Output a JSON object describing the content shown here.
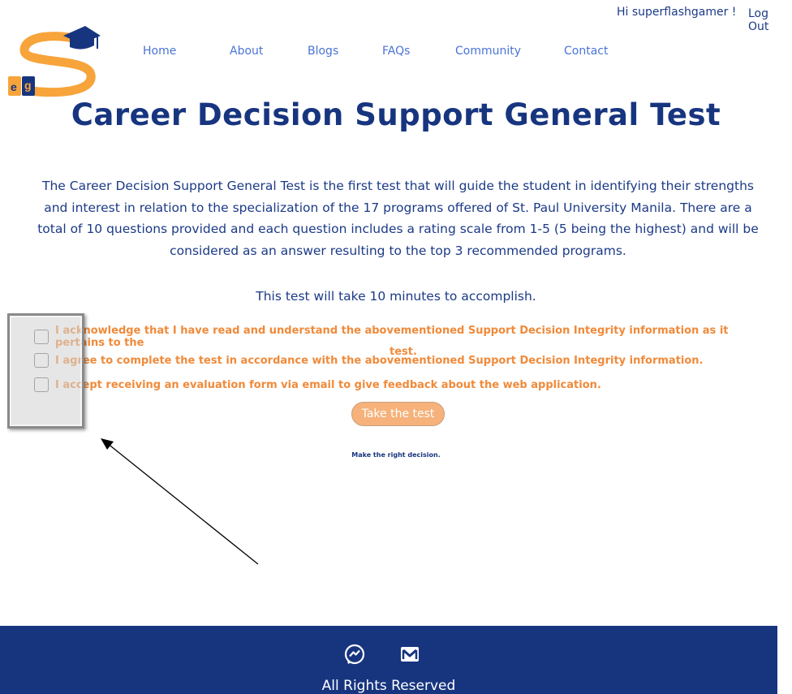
{
  "header": {
    "greeting": "Hi superflashgamer !",
    "logout": "Log Out",
    "logo_letters": "e g"
  },
  "nav": {
    "home": "Home",
    "about": "About",
    "blogs": "Blogs",
    "faqs": "FAQs",
    "community": "Community",
    "contact": "Contact"
  },
  "main": {
    "title": "Career Decision Support General Test",
    "intro": "The Career Decision Support General Test is the first test that will guide the student in identifying their strengths and interest in relation to the specialization of the 17 programs offered of St. Paul University Manila. There are a total of 10 questions provided and each question includes a rating scale from 1-5 (5 being the highest) and will be considered as an answer resulting to the top 3 recommended programs.",
    "duration": "This test will take 10 minutes to accomplish.",
    "checkboxes": {
      "acknowledge": "I acknowledge that I have read and understand the abovementioned Support Decision Integrity information as it pertains to the",
      "acknowledge_cont": "test.",
      "agree": "I agree to complete the test in accordance with the abovementioned Support Decision Integrity information.",
      "accept": "I accept receiving an evaluation form via email to give feedback about the web application."
    },
    "take_button": "Take the test",
    "motto": "Make the right decision."
  },
  "footer": {
    "rights": "All Rights Reserved",
    "icons": [
      "messenger-icon",
      "mail-icon"
    ]
  },
  "colors": {
    "navy": "#17357f",
    "orange": "#f08a3a",
    "button": "#f6b27a",
    "nav_link": "#4a73d6"
  }
}
